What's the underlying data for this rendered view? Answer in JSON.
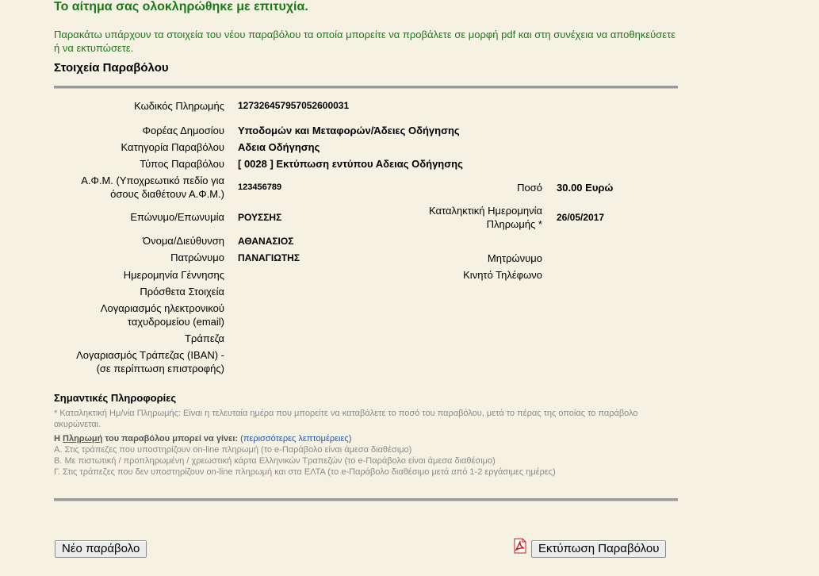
{
  "header": {
    "success": "Το αίτημα σας ολοκληρώθηκε με επιτυχία.",
    "intro": "Παρακάτω υπάρχουν τα στοιχεία του νέου παραβόλου τα οποία μπορείτε να προβάλετε σε μορφή pdf και στη συνέχεια να αποθηκεύσετε ή να εκτυπώσετε.",
    "section_title": "Στοιχεία Παραβόλου"
  },
  "fields": {
    "payment_code_label": "Κωδικός Πληρωμής",
    "payment_code": "127326457957052600031",
    "agency_label": "Φορέας Δημοσίου",
    "agency": "Υποδομών και Μεταφορών/Άδειες Οδήγησης",
    "category_label": "Κατηγορία Παραβόλου",
    "category": "Αδεια Οδήγησης",
    "type_label": "Τύπος Παραβόλου",
    "type": "[ 0028 ] Εκτύπωση εντύπου Αδειας Οδήγησης",
    "afm_label_1": "Α.Φ.Μ. (Υποχρεωτικό πεδίο για",
    "afm_label_2": "όσους διαθέτουν Α.Φ.Μ.)",
    "afm": "123456789",
    "amount_label": "Ποσό",
    "amount": "30.00 Ευρώ",
    "surname_label": "Επώνυμο/Επωνυμία",
    "surname": "ΡΟΥΣΣΗΣ",
    "deadline_label_1": "Καταληκτική Ημερομηνία",
    "deadline_label_2": "Πληρωμής *",
    "deadline": "26/05/2017",
    "name_label": "Όνομα/Διεύθυνση",
    "name": "ΑΘΑΝΑΣΙΟΣ",
    "father_label": "Πατρώνυμο",
    "father": "ΠΑΝΑΓΙΩΤΗΣ",
    "mother_label": "Μητρώνυμο",
    "birthdate_label": "Ημερομηνία Γέννησης",
    "mobile_label": "Κινητό Τηλέφωνο",
    "extra_label": "Πρόσθετα Στοιχεία",
    "email_label_1": "Λογαριασμός ηλεκτρονικού",
    "email_label_2": "ταχυδρομείου (email)",
    "bank_label": "Τράπεζα",
    "iban_label_1": "Λογαριασμός Τράπεζας (IBAN) -",
    "iban_label_2": "(σε περίπτωση επιστροφής)"
  },
  "info": {
    "title": "Σημαντικές Πληροφορίες",
    "deadline_note": "* Καταληκτική Ημ/νία Πληρωμής: Είναι η τελευταία ημέρα που μπορείτε να καταβάλετε το ποσό του παραβόλου, μετά το πέρας της οποίας το παράβολο ακυρώνεται.",
    "payment_prefix": "Η",
    "payment_word": "Πληρωμή",
    "payment_suffix": "του παραβόλου μπορεί να γίνει:",
    "more_open": "(",
    "more_link": "περισσότερες λεπτομέρειες",
    "more_close": ")",
    "option_a": "Α. Στις τράπεζες που υποστηρίζουν on-line πληρωμή (το e-Παράβολο είναι άμεσα διαθέσιμο)",
    "option_b": "Β. Με πιστωτική / προπληρωμένη / χρεωστική κάρτα Ελληνικών Τραπεζών (το e-Παράβολο είναι άμεσα διαθέσιμο)",
    "option_c": "Γ. Στις τράπεζες που δεν υποστηρίζουν on-line πληρωμή και στα ΕΛΤΑ (το e-Παράβολο διαθέσιμο μετά από 1-2 εργάσιμες ημέρες)"
  },
  "buttons": {
    "new": "Νέο παράβολο",
    "print": "Εκτύπωση Παραβόλου"
  },
  "icons": {
    "print_icon": "pdf-icon"
  }
}
